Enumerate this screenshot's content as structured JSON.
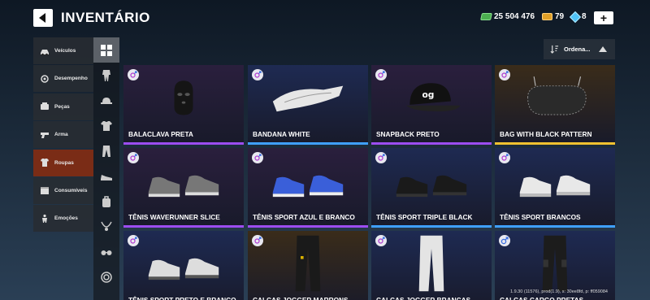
{
  "header": {
    "title": "INVENTÁRIO",
    "cash": "25 504 476",
    "gold": "79",
    "gems": "8",
    "add_label": "+"
  },
  "sidebar": {
    "items": [
      {
        "label": "Veículos",
        "icon": "car-icon"
      },
      {
        "label": "Desempenho",
        "icon": "engine-icon"
      },
      {
        "label": "Peças",
        "icon": "parts-icon"
      },
      {
        "label": "Arma",
        "icon": "gun-icon"
      },
      {
        "label": "Roupas",
        "icon": "shirt-icon",
        "active": true
      },
      {
        "label": "Consumíveis",
        "icon": "box-icon"
      },
      {
        "label": "Emoções",
        "icon": "person-icon"
      }
    ]
  },
  "categories": [
    "grid-icon",
    "jumpsuit-icon",
    "hat-icon",
    "shirt-icon",
    "pants-icon",
    "shoe-icon",
    "backpack-icon",
    "necklace-icon",
    "glasses-icon",
    "target-icon"
  ],
  "sort": {
    "label": "Ordena..."
  },
  "items": [
    {
      "name": "BALACLAVA PRETA",
      "gender": "unisex",
      "rarity": "#9c4df0",
      "bg": "#2a1f3d"
    },
    {
      "name": "BANDANA WHITE",
      "gender": "unisex",
      "rarity": "#3fa0ff",
      "bg": "#1e2a52"
    },
    {
      "name": "SNAPBACK PRETO",
      "gender": "unisex",
      "rarity": "#9c4df0",
      "bg": "#2a1f3d"
    },
    {
      "name": "BAG WITH BLACK PATTERN",
      "gender": "unisex",
      "rarity": "#f2c230",
      "bg": "#3a2c1a"
    },
    {
      "name": "TÊNIS WAVERUNNER SLICE",
      "gender": "unisex",
      "rarity": "#9c4df0",
      "bg": "#2a1f3d"
    },
    {
      "name": "TÊNIS SPORT AZUL E BRANCO",
      "gender": "unisex",
      "rarity": "#9c4df0",
      "bg": "#2a1f3d"
    },
    {
      "name": "TÊNIS SPORT TRIPLE BLACK",
      "gender": "unisex",
      "rarity": "#3fa0ff",
      "bg": "#1e2a52"
    },
    {
      "name": "TÊNIS SPORT BRANCOS",
      "gender": "unisex",
      "rarity": "#3fa0ff",
      "bg": "#1e2a52"
    },
    {
      "name": "TÊNIS SPORT PRETO E BRANCO",
      "gender": "unisex",
      "rarity": "#3fa0ff",
      "bg": "#1e2a52"
    },
    {
      "name": "CALÇAS JOGGER MARRONS",
      "gender": "unisex",
      "rarity": "#f2c230",
      "bg": "#3a2c1a"
    },
    {
      "name": "CALÇAS JOGGER BRANCAS",
      "gender": "unisex",
      "rarity": "#3fa0ff",
      "bg": "#1e2a52"
    },
    {
      "name": "CALÇAS CARGO PRETAS",
      "gender": "male",
      "rarity": "#3fa0ff",
      "bg": "#1e2a52"
    }
  ],
  "version": "1.9.30 (11576), prod(1.9), s: 30ee8fd, p: ff059084"
}
